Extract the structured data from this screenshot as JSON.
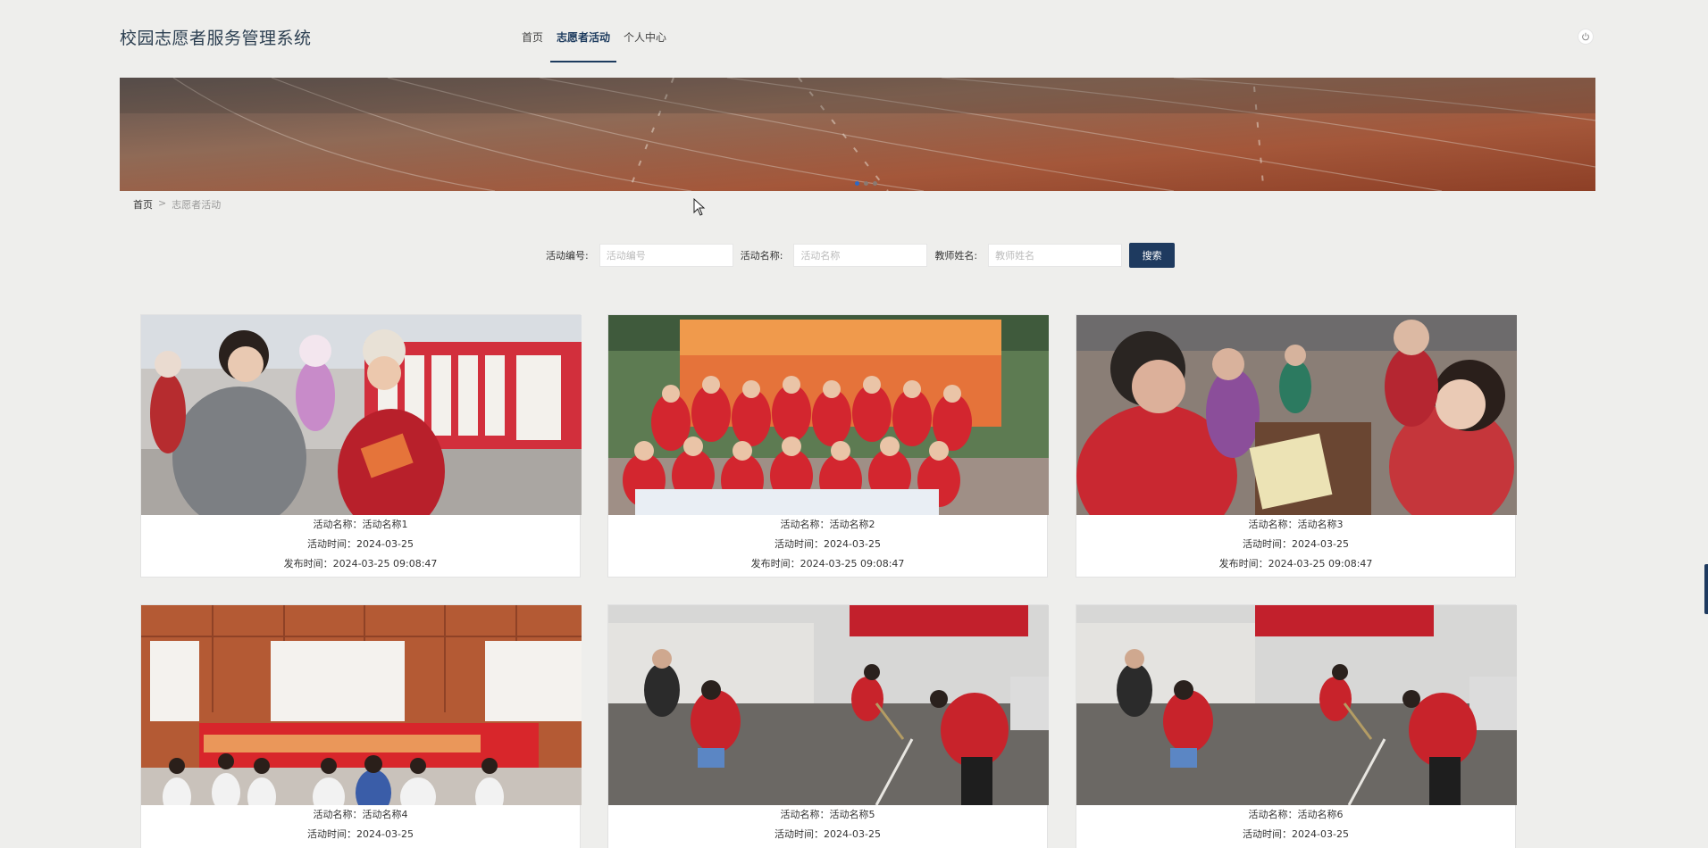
{
  "header": {
    "site_title": "校园志愿者服务管理系统",
    "nav": [
      {
        "label": "首页",
        "active": false
      },
      {
        "label": "志愿者活动",
        "active": true
      },
      {
        "label": "个人中心",
        "active": false
      }
    ],
    "power_icon": "power-icon"
  },
  "banner": {
    "slide_count": 3,
    "active_slide": 1
  },
  "breadcrumb": {
    "home": "首页",
    "separator": ">",
    "current": "志愿者活动"
  },
  "search": {
    "fields": [
      {
        "label": "活动编号:",
        "placeholder": "活动编号",
        "value": ""
      },
      {
        "label": "活动名称:",
        "placeholder": "活动名称",
        "value": ""
      },
      {
        "label": "教师姓名:",
        "placeholder": "教师姓名",
        "value": ""
      }
    ],
    "button": "搜索"
  },
  "cards": [
    {
      "name": "活动名称：活动名称1",
      "time": "活动时间：2024-03-25",
      "published": "发布时间：2024-03-25 09:08:47"
    },
    {
      "name": "活动名称：活动名称2",
      "time": "活动时间：2024-03-25",
      "published": "发布时间：2024-03-25 09:08:47"
    },
    {
      "name": "活动名称：活动名称3",
      "time": "活动时间：2024-03-25",
      "published": "发布时间：2024-03-25 09:08:47"
    },
    {
      "name": "活动名称：活动名称4",
      "time": "活动时间：2024-03-25",
      "published": ""
    },
    {
      "name": "活动名称：活动名称5",
      "time": "活动时间：2024-03-25",
      "published": ""
    },
    {
      "name": "活动名称：活动名称6",
      "time": "活动时间：2024-03-25",
      "published": ""
    }
  ],
  "colors": {
    "primary": "#1e3a5f",
    "page_bg": "#eeeeec"
  }
}
